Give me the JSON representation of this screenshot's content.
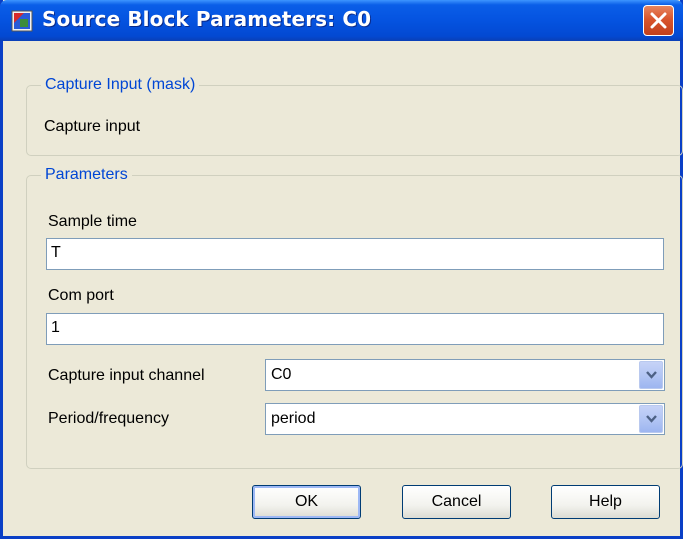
{
  "window": {
    "title": "Source Block Parameters: C0",
    "close_icon": "close-icon",
    "app_icon": "simulink-block-icon",
    "accent": "#0a3fc6",
    "close_color": "#d9552d"
  },
  "mask_group": {
    "legend": "Capture Input (mask)",
    "description": "Capture input"
  },
  "params_group": {
    "legend": "Parameters",
    "sample_time": {
      "label": "Sample time",
      "value": "T"
    },
    "com_port": {
      "label": "Com port",
      "value": "1"
    },
    "capture_channel": {
      "label": "Capture input channel",
      "value": "C0"
    },
    "period_frequency": {
      "label": "Period/frequency",
      "value": "period"
    }
  },
  "buttons": {
    "ok": "OK",
    "cancel": "Cancel",
    "help": "Help"
  },
  "legend_color": "#0046d5"
}
